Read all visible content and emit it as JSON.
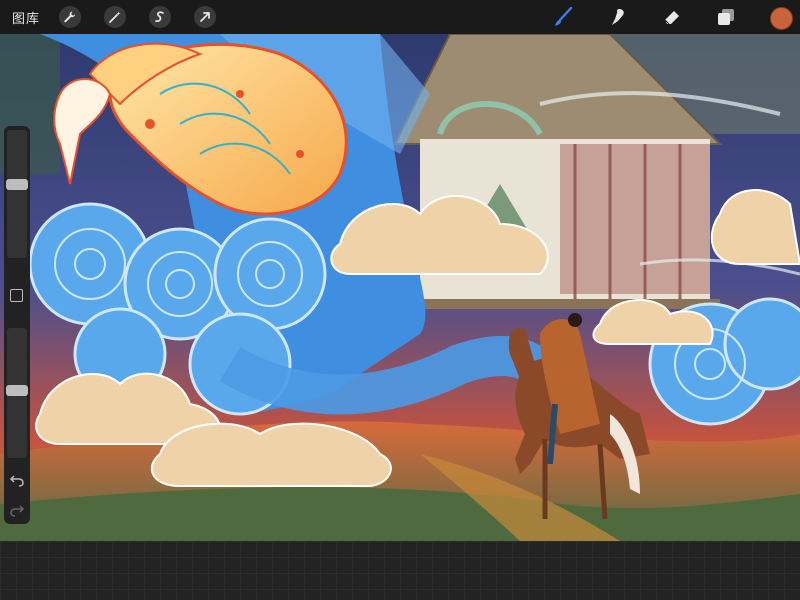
{
  "topbar": {
    "gallery_label": "图库",
    "left_tools": [
      "wrench-icon",
      "magic-wand-icon",
      "selection-icon",
      "transform-arrow-icon"
    ],
    "right_tools": [
      "brush-icon",
      "smudge-icon",
      "eraser-icon",
      "layers-icon"
    ],
    "active_tool": "brush-icon",
    "current_color": "#c8643c"
  },
  "sidebar": {
    "brush_size_level": 0.58,
    "opacity_level": 0.52,
    "controls": [
      "brush-size-slider",
      "modify-button",
      "opacity-slider",
      "undo-icon",
      "redo-icon"
    ]
  },
  "colors": {
    "accent_blue": "#3c7ff0",
    "toolbar_bg": "#1a1a1a"
  }
}
